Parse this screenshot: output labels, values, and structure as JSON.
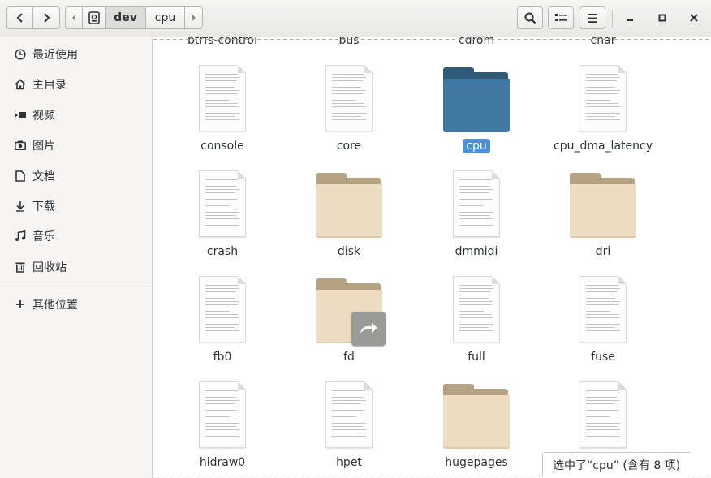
{
  "header": {
    "path": [
      "dev",
      "cpu"
    ],
    "icons": {
      "back": "chevron-left-icon",
      "forward": "chevron-right-icon",
      "path_left": "triangle-left-icon",
      "path_right": "triangle-right-icon",
      "device": "drive-icon",
      "search": "search-icon",
      "view": "list-view-icon",
      "menu": "hamburger-menu-icon",
      "minimize": "minimize-icon",
      "maximize": "maximize-icon",
      "close": "close-icon"
    }
  },
  "sidebar": {
    "items": [
      {
        "label": "最近使用",
        "icon": "clock-icon"
      },
      {
        "label": "主目录",
        "icon": "home-icon"
      },
      {
        "label": "视频",
        "icon": "video-icon"
      },
      {
        "label": "图片",
        "icon": "camera-icon"
      },
      {
        "label": "文档",
        "icon": "document-icon"
      },
      {
        "label": "下载",
        "icon": "download-icon"
      },
      {
        "label": "音乐",
        "icon": "music-icon"
      },
      {
        "label": "回收站",
        "icon": "trash-icon"
      },
      {
        "label": "其他位置",
        "icon": "plus-icon"
      }
    ]
  },
  "files": {
    "top_row": [
      "btrfs-control",
      "bus",
      "cdrom",
      "char"
    ],
    "items": [
      {
        "name": "console",
        "type": "file"
      },
      {
        "name": "core",
        "type": "file"
      },
      {
        "name": "cpu",
        "type": "folder",
        "selected": true
      },
      {
        "name": "cpu_dma_latency",
        "type": "file"
      },
      {
        "name": "crash",
        "type": "file"
      },
      {
        "name": "disk",
        "type": "folder"
      },
      {
        "name": "dmmidi",
        "type": "file"
      },
      {
        "name": "dri",
        "type": "folder"
      },
      {
        "name": "fb0",
        "type": "file"
      },
      {
        "name": "fd",
        "type": "folder",
        "symlink": true
      },
      {
        "name": "full",
        "type": "file"
      },
      {
        "name": "fuse",
        "type": "file"
      },
      {
        "name": "hidraw0",
        "type": "file"
      },
      {
        "name": "hpet",
        "type": "file"
      },
      {
        "name": "hugepages",
        "type": "folder"
      },
      {
        "name": "",
        "type": "file"
      }
    ]
  },
  "status": {
    "text": "选中了“cpu” (含有 8 项)"
  },
  "colors": {
    "selection": "#4a90d9",
    "folder_tan": "#ecdcc2",
    "folder_blue": "#3f78a1"
  }
}
